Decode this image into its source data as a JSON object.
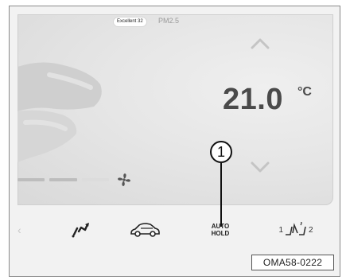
{
  "air_quality": {
    "badge": "Excellent 32",
    "label": "PM2.5"
  },
  "climate": {
    "temperature": "21.0",
    "unit": "°C",
    "fan_level_fraction": 0.6
  },
  "bottom_bar": {
    "recirculation_icon": "air-recirculation-icon",
    "car_icon": "car-air-icon",
    "auto_hold": {
      "line1": "AUTO",
      "line2": "HOLD"
    },
    "seat_heat": {
      "left": "1",
      "right": "2",
      "icon": "seat-heat-icon"
    }
  },
  "callout": {
    "number": "1"
  },
  "figure": {
    "code": "OMA58-0222"
  },
  "colors": {
    "screen_bg": "#e6e6e6",
    "text_dark": "#4a4a4a",
    "fan_bar": "#bdbdbd"
  }
}
